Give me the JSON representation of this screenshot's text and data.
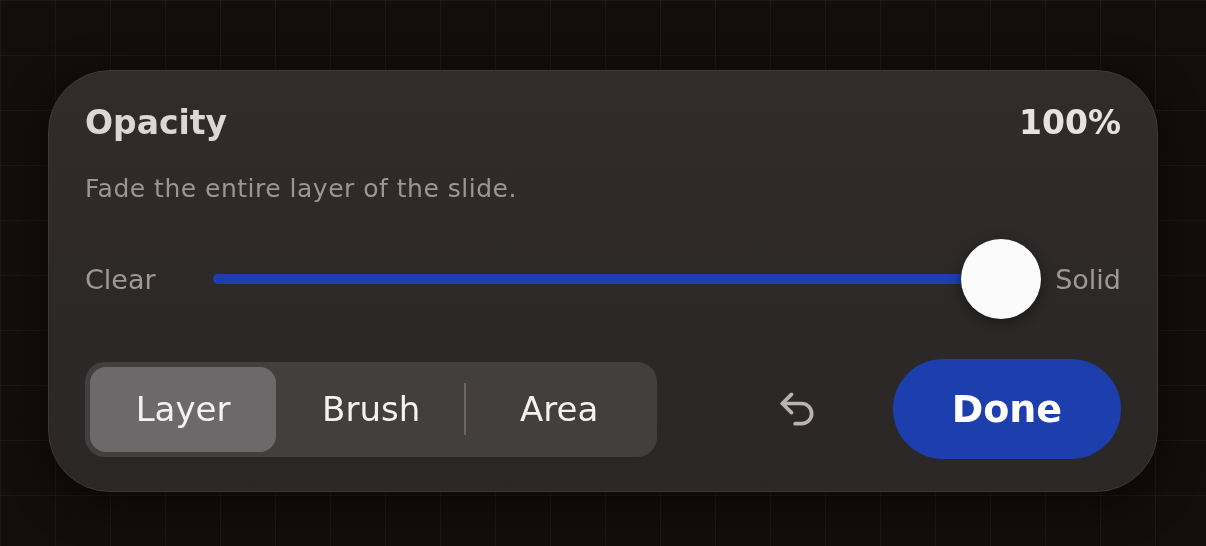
{
  "panel": {
    "title": "Opacity",
    "value": "100%",
    "description": "Fade the entire layer of the slide."
  },
  "slider": {
    "min_label": "Clear",
    "max_label": "Solid",
    "level": 1
  },
  "modes": [
    {
      "label": "Layer",
      "selected": true
    },
    {
      "label": "Brush",
      "selected": false
    },
    {
      "label": "Area",
      "selected": false
    }
  ],
  "done_button": "Done"
}
